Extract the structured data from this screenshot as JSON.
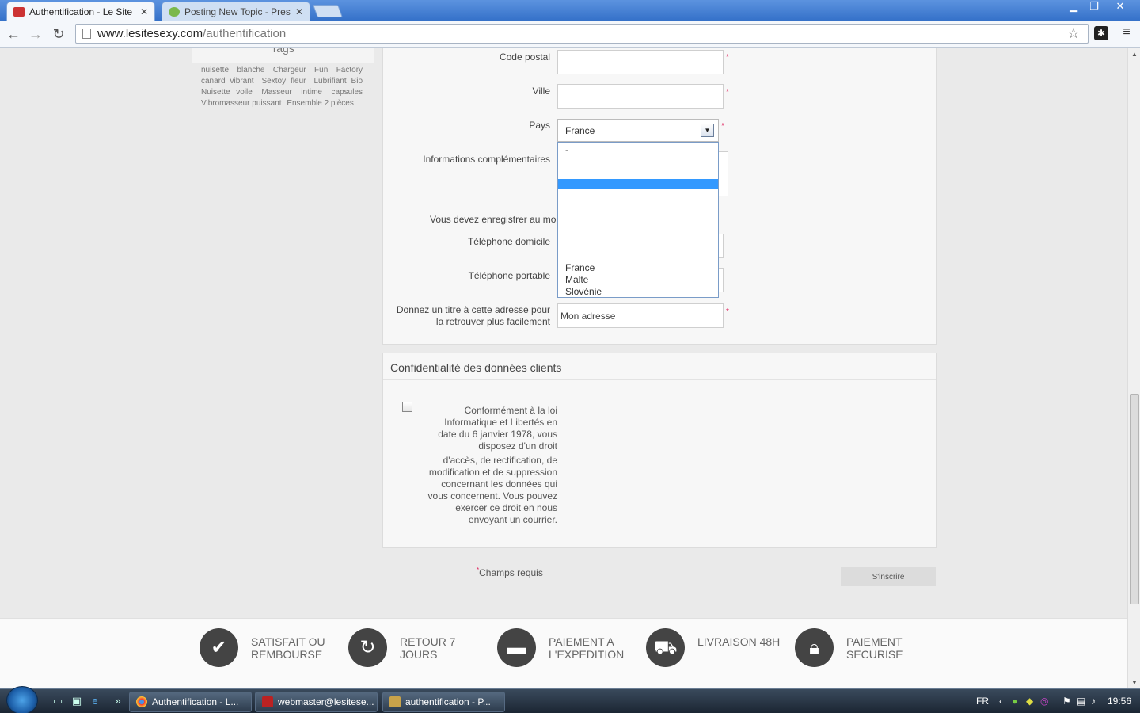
{
  "browser": {
    "tabs": [
      {
        "title": "Authentification - Le Site S",
        "active": true
      },
      {
        "title": "Posting New Topic - Prest",
        "active": false
      }
    ],
    "close_glyph": "✕",
    "url_domain": "www.lesitesexy.com",
    "url_path": "/authentification",
    "icons": [
      "back-icon",
      "forward-icon",
      "reload-icon",
      "star-icon",
      "extension-icon",
      "menu-icon",
      "minimize-icon",
      "restore-icon",
      "close-icon"
    ]
  },
  "sidebar": {
    "tags_heading": "Tags",
    "tags": [
      "nuisette",
      "blanche",
      "Chargeur",
      "Fun",
      "Factory",
      "canard vibrant",
      "Sextoy fleur",
      "Lubrifiant Bio",
      "Nuisette voile",
      "Masseur",
      "intime",
      "capsules",
      "Vibromasseur puissant",
      "Ensemble 2 pièces"
    ]
  },
  "form": {
    "postal_code_label": "Code postal",
    "city_label": "Ville",
    "country_label": "Pays",
    "country_value": "France",
    "extra_info_label": "Informations complémentaires",
    "phone_notice": "Vous devez enregistrer au mo",
    "home_phone_label": "Téléphone domicile",
    "mobile_phone_label": "Téléphone portable",
    "alias_label_line1": "Donnez un titre à cette adresse pour",
    "alias_label_line2": "la retrouver plus facilement",
    "alias_value": "Mon adresse",
    "required_mark": "*",
    "country_options": [
      "-",
      "France",
      "Malte",
      "Slovénie"
    ]
  },
  "privacy": {
    "title": "Confidentialité des données clients",
    "text_part1": "Conformément à la loi Informatique et Libertés en date du 6 janvier 1978, vous disposez d'un droit",
    "text_part2": "d'accès, de rectification, de modification et de suppression concernant les données qui vous concernent. Vous pouvez exercer ce droit en nous envoyant un courrier."
  },
  "actions": {
    "required_note": "Champs requis",
    "submit_label": "S'inscrire"
  },
  "footer": {
    "features": [
      {
        "line1": "SATISFAIT OU",
        "line2": "REMBOURSE",
        "icon": "checkmark-icon"
      },
      {
        "line1": "RETOUR 7",
        "line2": "JOURS",
        "icon": "return-icon"
      },
      {
        "line1": "PAIEMENT A",
        "line2": "L'EXPEDITION",
        "icon": "card-icon"
      },
      {
        "line1": "LIVRAISON 48H",
        "line2": "",
        "icon": "truck-icon"
      },
      {
        "line1": "PAIEMENT",
        "line2": "SECURISE",
        "icon": "lock-icon"
      }
    ]
  },
  "taskbar": {
    "tasks": [
      "Authentification - L...",
      "webmaster@lesitese...",
      "authentification - P..."
    ],
    "language": "FR",
    "clock": "19:56"
  }
}
